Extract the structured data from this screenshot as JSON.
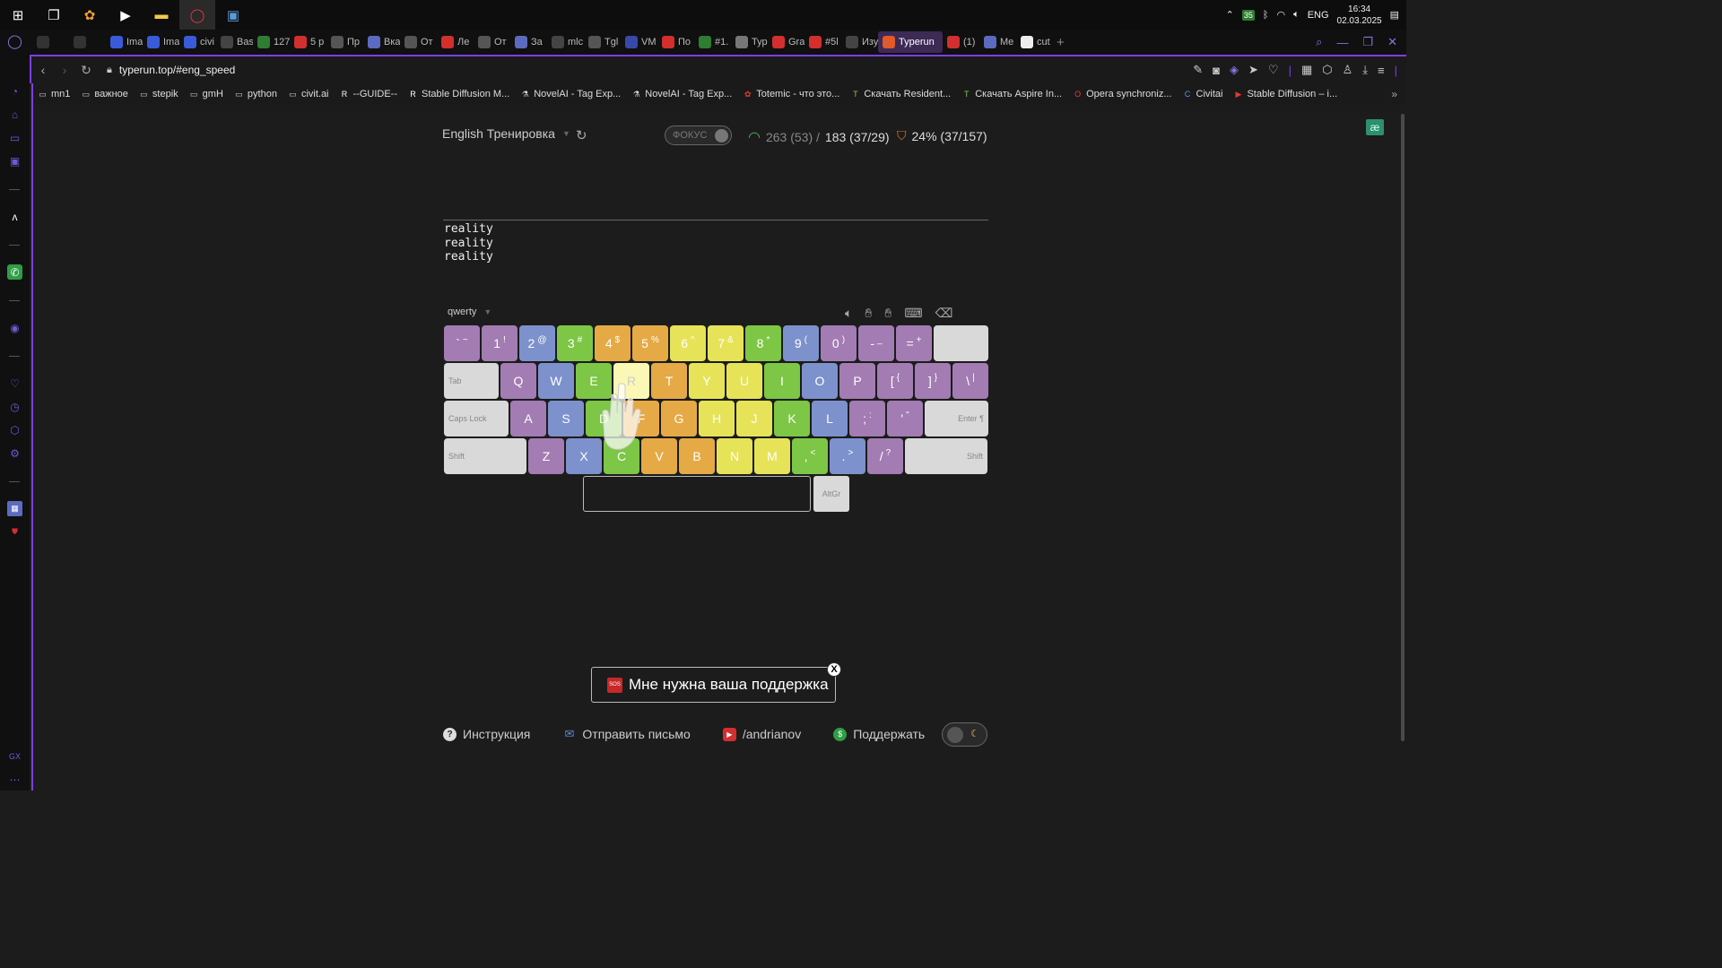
{
  "taskbar": {
    "apps": [
      {
        "name": "start-icon",
        "glyph": "⊞"
      },
      {
        "name": "task-view-icon",
        "glyph": "❐"
      },
      {
        "name": "copilot-icon",
        "glyph": "✿"
      },
      {
        "name": "media-player-icon",
        "glyph": "▶"
      },
      {
        "name": "file-explorer-icon",
        "glyph": "▬"
      },
      {
        "name": "opera-gx-icon",
        "glyph": "◯"
      },
      {
        "name": "remote-desktop-icon",
        "glyph": "▣"
      }
    ],
    "tray_badge": "35",
    "language": "ENG",
    "time": "16:34",
    "date": "02.03.2025"
  },
  "tabs": [
    {
      "label": "",
      "icon": "gamepad-icon",
      "color": "#333"
    },
    {
      "label": "",
      "icon": "sd-icon",
      "color": "#333"
    },
    {
      "label": "Ima",
      "icon": "c-icon",
      "color": "#3a5bd9"
    },
    {
      "label": "Ima",
      "icon": "c-icon",
      "color": "#3a5bd9"
    },
    {
      "label": "civi",
      "icon": "c-icon",
      "color": "#3a5bd9"
    },
    {
      "label": "Bas",
      "icon": "github-icon",
      "color": "#444"
    },
    {
      "label": "127",
      "icon": "leaf-icon",
      "color": "#2e7d32"
    },
    {
      "label": "5 p",
      "icon": "youtube-icon",
      "color": "#d32f2f"
    },
    {
      "label": "Пр",
      "icon": "doc-icon",
      "color": "#555"
    },
    {
      "label": "Вка",
      "icon": "star-icon",
      "color": "#5c6bc0"
    },
    {
      "label": "От",
      "icon": "doc-icon",
      "color": "#555"
    },
    {
      "label": "Ле",
      "icon": "youtube-icon",
      "color": "#d32f2f"
    },
    {
      "label": "От",
      "icon": "doc-icon",
      "color": "#555"
    },
    {
      "label": "За",
      "icon": "star-icon",
      "color": "#5c6bc0"
    },
    {
      "label": "mlc",
      "icon": "github-icon",
      "color": "#444"
    },
    {
      "label": "Tgl",
      "icon": "doc-icon",
      "color": "#555"
    },
    {
      "label": "VM",
      "icon": "vm-icon",
      "color": "#3949ab"
    },
    {
      "label": "По",
      "icon": "youtube-icon",
      "color": "#d32f2f"
    },
    {
      "label": "#1.",
      "icon": "globe-icon",
      "color": "#2e7d32"
    },
    {
      "label": "Тур",
      "icon": "photo-icon",
      "color": "#777"
    },
    {
      "label": "Gra",
      "icon": "youtube-icon",
      "color": "#d32f2f"
    },
    {
      "label": "#5l",
      "icon": "youtube-icon",
      "color": "#d32f2f"
    },
    {
      "label": "Изу",
      "icon": "openai-icon",
      "color": "#444"
    },
    {
      "label": "Typerun",
      "icon": "typerun-icon",
      "color": "#e05a2b",
      "active": true
    },
    {
      "label": "(1)",
      "icon": "youtube-icon",
      "color": "#d32f2f"
    },
    {
      "label": "Me",
      "icon": "chat-icon",
      "color": "#5c6bc0"
    },
    {
      "label": "cut",
      "icon": "google-icon",
      "color": "#eee"
    }
  ],
  "address": {
    "url": "typerun.top/#eng_speed"
  },
  "bookmarks": [
    {
      "label": "mn1",
      "icon": "folder-icon"
    },
    {
      "label": "важное",
      "icon": "folder-icon"
    },
    {
      "label": "stepik",
      "icon": "folder-icon"
    },
    {
      "label": "gmH",
      "icon": "folder-icon"
    },
    {
      "label": "python",
      "icon": "folder-icon"
    },
    {
      "label": "civit.ai",
      "icon": "folder-icon"
    },
    {
      "label": "--GUIDE--",
      "icon": "r-icon"
    },
    {
      "label": "Stable Diffusion M...",
      "icon": "r-icon"
    },
    {
      "label": "NovelAI - Tag Exp...",
      "icon": "flask-icon"
    },
    {
      "label": "NovelAI - Tag Exp...",
      "icon": "flask-icon"
    },
    {
      "label": "Totemic - что это...",
      "icon": "totem-icon"
    },
    {
      "label": "Скачать Resident...",
      "icon": "tl-icon"
    },
    {
      "label": "Скачать Aspire In...",
      "icon": "tl-icon"
    },
    {
      "label": "Opera synchroniz...",
      "icon": "opera-icon"
    },
    {
      "label": "Civitai",
      "icon": "c-icon"
    },
    {
      "label": "Stable Diffusion – i...",
      "icon": "youtube-icon"
    }
  ],
  "app": {
    "mode_label": "English Тренировка",
    "focus_label": "ФОКУС",
    "speed_dim": "263 (53) /",
    "speed_main": "183 (37/29)",
    "accuracy": "24% (37/157)",
    "text_lines": [
      "reality",
      "reality",
      "reality"
    ],
    "layout_label": "qwerty",
    "support_text": "Мне нужна ваша поддержка",
    "support_close": "X",
    "sos_label": "SOS"
  },
  "keyboard": {
    "rows": [
      [
        {
          "main": "`",
          "sub": "~",
          "color": "purple",
          "w": 40
        },
        {
          "main": "1",
          "sub": "!",
          "color": "purple",
          "w": 40
        },
        {
          "main": "2",
          "sub": "@",
          "color": "blue",
          "w": 40
        },
        {
          "main": "3",
          "sub": "#",
          "color": "green",
          "w": 40
        },
        {
          "main": "4",
          "sub": "$",
          "color": "orange",
          "w": 40
        },
        {
          "main": "5",
          "sub": "%",
          "color": "orange",
          "w": 40
        },
        {
          "main": "6",
          "sub": "^",
          "color": "yellow",
          "w": 40
        },
        {
          "main": "7",
          "sub": "&",
          "color": "yellow",
          "w": 40
        },
        {
          "main": "8",
          "sub": "*",
          "color": "green",
          "w": 40
        },
        {
          "main": "9",
          "sub": "(",
          "color": "blue",
          "w": 40
        },
        {
          "main": "0",
          "sub": ")",
          "color": "purple",
          "w": 40
        },
        {
          "main": "-",
          "sub": "_",
          "color": "purple",
          "w": 40
        },
        {
          "main": "=",
          "sub": "+",
          "color": "purple",
          "w": 40
        },
        {
          "main": "",
          "sub": "",
          "color": "gray",
          "w": 61
        }
      ],
      [
        {
          "main": "Tab",
          "sub": "",
          "color": "gray",
          "w": 61
        },
        {
          "main": "Q",
          "sub": "",
          "color": "purple",
          "w": 40
        },
        {
          "main": "W",
          "sub": "",
          "color": "blue",
          "w": 40
        },
        {
          "main": "E",
          "sub": "",
          "color": "green",
          "w": 40
        },
        {
          "main": "R",
          "sub": "",
          "color": "yellowlight",
          "w": 40
        },
        {
          "main": "T",
          "sub": "",
          "color": "orange",
          "w": 40
        },
        {
          "main": "Y",
          "sub": "",
          "color": "yellow",
          "w": 40
        },
        {
          "main": "U",
          "sub": "",
          "color": "yellow",
          "w": 40
        },
        {
          "main": "I",
          "sub": "",
          "color": "green",
          "w": 40
        },
        {
          "main": "O",
          "sub": "",
          "color": "blue",
          "w": 40
        },
        {
          "main": "P",
          "sub": "",
          "color": "purple",
          "w": 40
        },
        {
          "main": "[",
          "sub": "{",
          "color": "purple",
          "w": 40
        },
        {
          "main": "]",
          "sub": "}",
          "color": "purple",
          "w": 40
        },
        {
          "main": "\\",
          "sub": "|",
          "color": "purple",
          "w": 40
        }
      ],
      [
        {
          "main": "Caps Lock",
          "sub": "",
          "color": "gray",
          "w": 72
        },
        {
          "main": "A",
          "sub": "",
          "color": "purple",
          "w": 40
        },
        {
          "main": "S",
          "sub": "",
          "color": "blue",
          "w": 40
        },
        {
          "main": "D",
          "sub": "",
          "color": "green",
          "w": 40
        },
        {
          "main": "F",
          "sub": "",
          "color": "orange",
          "w": 40
        },
        {
          "main": "G",
          "sub": "",
          "color": "orange",
          "w": 40
        },
        {
          "main": "H",
          "sub": "",
          "color": "yellow",
          "w": 40
        },
        {
          "main": "J",
          "sub": "",
          "color": "yellow",
          "w": 40
        },
        {
          "main": "K",
          "sub": "",
          "color": "green",
          "w": 40
        },
        {
          "main": "L",
          "sub": "",
          "color": "blue",
          "w": 40
        },
        {
          "main": ";",
          "sub": ":",
          "color": "purple",
          "w": 40
        },
        {
          "main": "'",
          "sub": "\"",
          "color": "purple",
          "w": 40
        },
        {
          "main": "Enter ¶",
          "sub": "",
          "color": "gray-right",
          "w": 71
        }
      ],
      [
        {
          "main": "Shift",
          "sub": "",
          "color": "gray",
          "w": 92
        },
        {
          "main": "Z",
          "sub": "",
          "color": "purple",
          "w": 40
        },
        {
          "main": "X",
          "sub": "",
          "color": "blue",
          "w": 40
        },
        {
          "main": "C",
          "sub": "",
          "color": "green",
          "w": 40
        },
        {
          "main": "V",
          "sub": "",
          "color": "orange",
          "w": 40
        },
        {
          "main": "B",
          "sub": "",
          "color": "orange",
          "w": 40
        },
        {
          "main": "N",
          "sub": "",
          "color": "yellow",
          "w": 40
        },
        {
          "main": "M",
          "sub": "",
          "color": "yellow",
          "w": 40
        },
        {
          "main": ",",
          "sub": "<",
          "color": "green",
          "w": 40
        },
        {
          "main": ".",
          "sub": ">",
          "color": "blue",
          "w": 40
        },
        {
          "main": "/",
          "sub": "?",
          "color": "purple",
          "w": 40
        },
        {
          "main": "Shift",
          "sub": "",
          "color": "gray-right",
          "w": 92
        }
      ]
    ],
    "altgr_label": "AltGr"
  },
  "footer": {
    "instruction": "Инструкция",
    "send_mail": "Отправить письмо",
    "youtube": "/andrianov",
    "support": "Поддержать"
  }
}
